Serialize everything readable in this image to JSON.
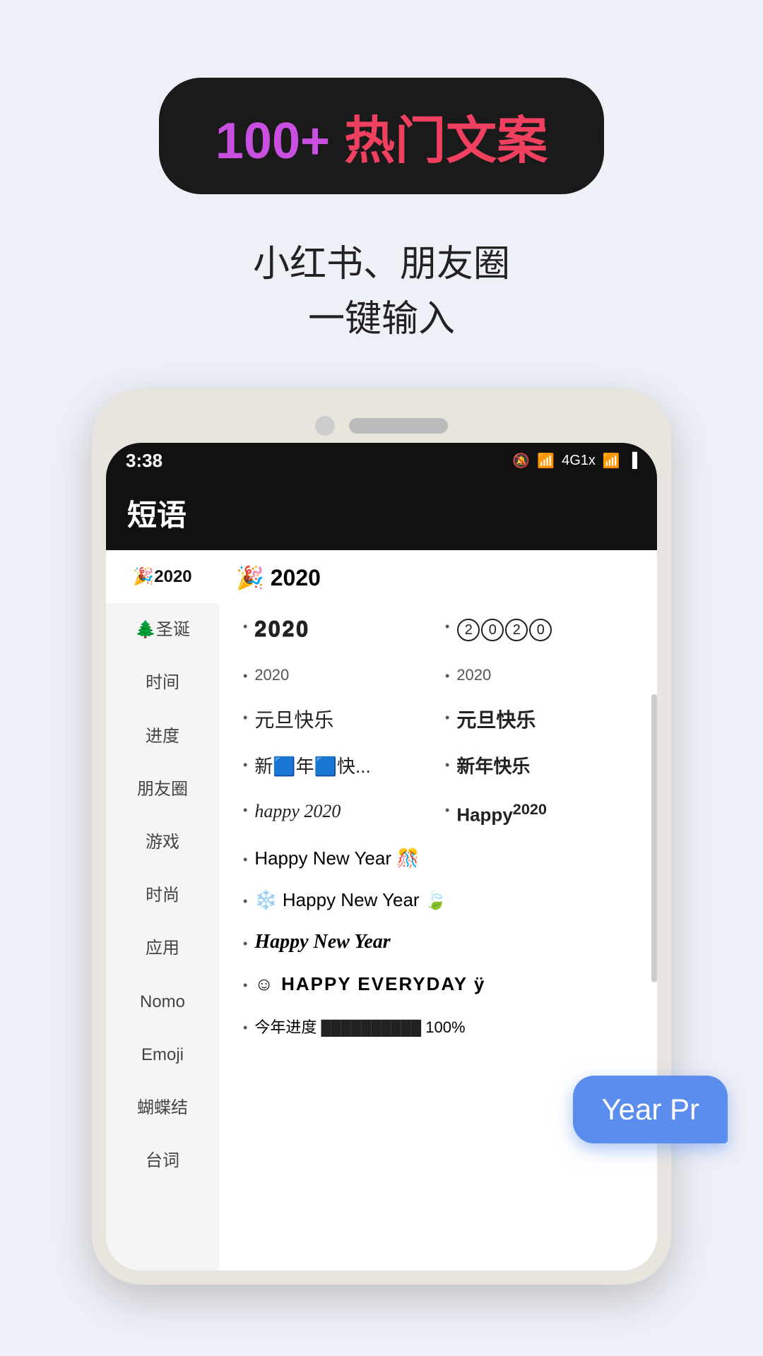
{
  "badge": {
    "number": "100+",
    "label": "热门文案"
  },
  "subtitle": {
    "line1": "小红书、朋友圈",
    "line2": "一键输入"
  },
  "phone": {
    "status_bar": {
      "time": "3:38",
      "icons": "🔕 📶 4G 📶 🔋"
    },
    "app_title": "短语",
    "sidebar": {
      "items": [
        {
          "label": "🎉2020",
          "active": true
        },
        {
          "label": "🌲圣诞",
          "active": false
        },
        {
          "label": "时间",
          "active": false
        },
        {
          "label": "进度",
          "active": false
        },
        {
          "label": "朋友圈",
          "active": false
        },
        {
          "label": "游戏",
          "active": false
        },
        {
          "label": "时尚",
          "active": false
        },
        {
          "label": "应用",
          "active": false
        },
        {
          "label": "Nomo",
          "active": false
        },
        {
          "label": "Emoji",
          "active": false
        },
        {
          "label": "蝴蝶结",
          "active": false
        },
        {
          "label": "台词",
          "active": false
        }
      ]
    },
    "content": {
      "section_title": "🎉 2020",
      "items": [
        {
          "text": "2020",
          "style": "serif-bold",
          "col": 1
        },
        {
          "text": "②⓪②⓪",
          "style": "circled",
          "col": 2
        },
        {
          "text": "2020",
          "style": "small",
          "col": 1
        },
        {
          "text": "2020",
          "style": "small",
          "col": 2
        },
        {
          "text": "元旦快乐",
          "style": "normal",
          "col": 1
        },
        {
          "text": "元旦快乐",
          "style": "bold",
          "col": 2
        },
        {
          "text": "新🟦年🟦快...",
          "style": "normal",
          "col": 1
        },
        {
          "text": "新年快乐",
          "style": "bold-partial",
          "col": 2
        },
        {
          "text": "happy 2020",
          "style": "italic",
          "col": 1
        },
        {
          "text": "Happy²⁰²⁰",
          "style": "bold-super",
          "col": 2
        },
        {
          "text": "Happy New Year 🎊",
          "style": "normal",
          "col": "full"
        },
        {
          "text": "❄️ Happy New Year 🍃",
          "style": "normal",
          "col": "full"
        },
        {
          "text": "Happy New Year",
          "style": "script",
          "col": "full"
        },
        {
          "text": "☺ HAPPY EVERYDAY ÿ",
          "style": "caps",
          "col": "full"
        },
        {
          "text": "今年进度 ██████████ 100%",
          "style": "progress",
          "col": "full"
        }
      ]
    },
    "bubble": {
      "text": "Year Pr"
    }
  }
}
